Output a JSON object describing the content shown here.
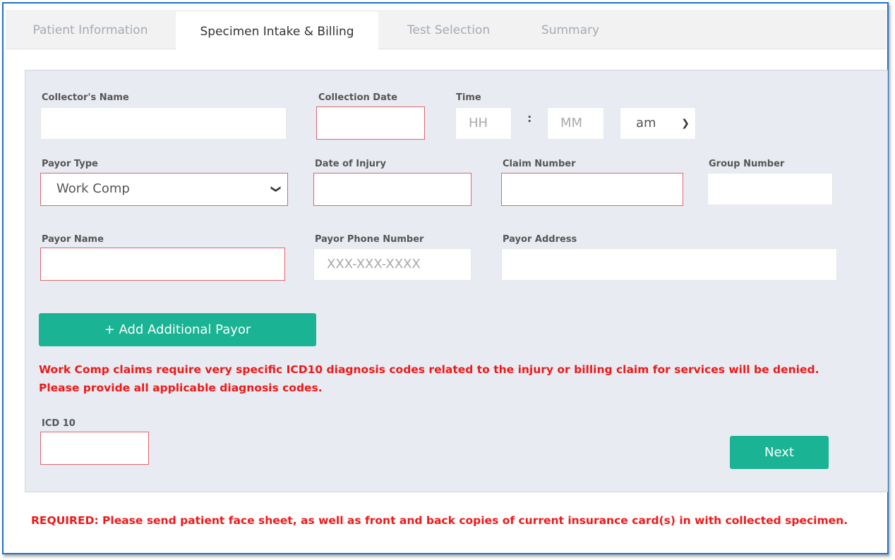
{
  "tabs": [
    "Patient Information",
    "Specimen Intake & Billing",
    "Test Selection",
    "Summary"
  ],
  "active_tab": 1,
  "form": {
    "collectors_name_label": "Collector's Name",
    "collection_date_label": "Collection Date",
    "time_label": "Time",
    "hh_placeholder": "HH",
    "time_separator": ":",
    "mm_placeholder": "MM",
    "ampm_value": "am",
    "payor_type_label": "Payor Type",
    "payor_type_value": "Work Comp",
    "date_of_injury_label": "Date of Injury",
    "claim_number_label": "Claim Number",
    "group_number_label": "Group Number",
    "payor_name_label": "Payor Name",
    "payor_phone_label": "Payor Phone Number",
    "payor_phone_placeholder": "XXX-XXX-XXXX",
    "payor_address_label": "Payor Address",
    "add_payor_button": "+ Add Additional Payor",
    "warning_line1": "Work Comp claims require very specific ICD10 diagnosis codes related to the injury or billing claim for services will be denied.",
    "warning_line2": "Please provide all applicable diagnosis codes.",
    "icd10_label": "ICD 10",
    "next_button": "Next"
  },
  "required_note": "REQUIRED: Please send patient face sheet, as well as front and back copies of current insurance card(s) in with collected specimen.",
  "colors": {
    "accent": "#1ab394",
    "required_border": "#e0646e",
    "warning_text": "#f01818",
    "frame": "#1f72c4"
  }
}
